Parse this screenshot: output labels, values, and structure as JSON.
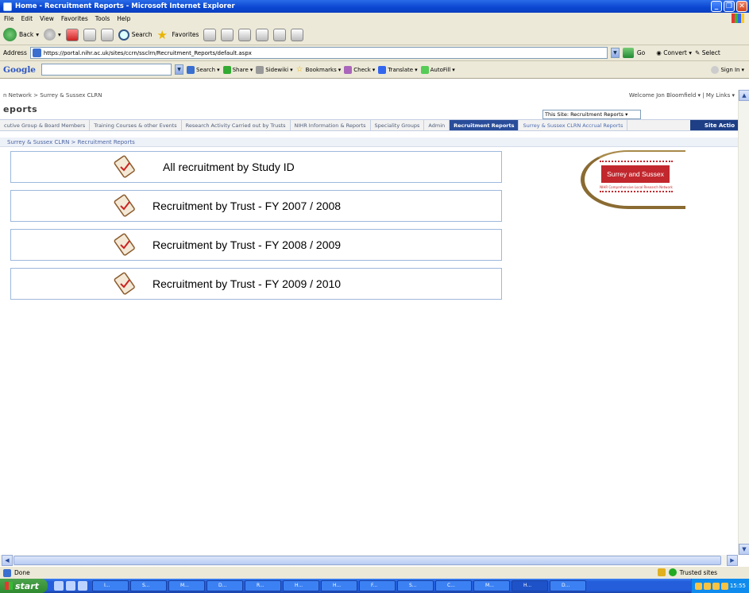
{
  "window": {
    "title": "Home - Recruitment Reports - Microsoft Internet Explorer"
  },
  "menu": [
    "File",
    "Edit",
    "View",
    "Favorites",
    "Tools",
    "Help"
  ],
  "toolbar": {
    "back": "Back",
    "search": "Search",
    "favorites": "Favorites"
  },
  "address": {
    "label": "Address",
    "url": "https://portal.nihr.ac.uk/sites/ccrn/ssclrn/Recruitment_Reports/default.aspx",
    "go": "Go",
    "convert": "Convert",
    "select": "Select"
  },
  "googlebar": {
    "logo": "Google",
    "search": "Search",
    "share": "Share",
    "sidewiki": "Sidewiki",
    "bookmarks": "Bookmarks",
    "check": "Check",
    "translate": "Translate",
    "autofill": "AutoFill",
    "signin": "Sign In"
  },
  "site": {
    "breadcrumb_top": "n Network > Surrey & Sussex CLRN",
    "welcome": "Welcome Jon Bloomfield ▾  |  My Links ▾",
    "title": "eports",
    "scope": "This Site: Recruitment Reports",
    "tabs": [
      "cutive Group & Board Members",
      "Training Courses & other Events",
      "Research Activity Carried out by Trusts",
      "NIHR Information & Reports",
      "Speciality Groups",
      "Admin",
      "Recruitment Reports",
      "Surrey & Sussex CLRN Accrual Reports"
    ],
    "site_actions": "Site Actio",
    "crumb": "Surrey & Sussex CLRN > Recruitment Reports"
  },
  "reports": [
    "All recruitment by Study ID",
    "Recruitment by Trust - FY 2007 / 2008",
    "Recruitment by Trust - FY  2008 / 2009",
    "Recruitment by Trust - FY 2009 / 2010"
  ],
  "logo": {
    "name": "Surrey and Sussex",
    "sub": "NIHR Comprehensive Local Research Network"
  },
  "status": {
    "text": "Done",
    "zone": "Trusted sites"
  },
  "taskbar": {
    "start": "start",
    "clock": "15:55",
    "tasks": [
      "I...",
      "S...",
      "M...",
      "D...",
      "R...",
      "H...",
      "H...",
      "F...",
      "S...",
      "C...",
      "M...",
      "H...",
      "D..."
    ]
  }
}
